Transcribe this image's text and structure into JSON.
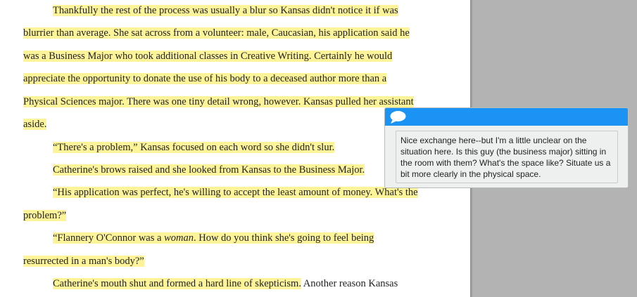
{
  "document": {
    "lines": [
      {
        "hl": "Thankfully the rest of the process was usually a blur so Kansas didn't notice it if was"
      },
      {
        "hl": "blurrier than average. She sat across from a volunteer: male, Caucasian, his application said he"
      },
      {
        "hl": "was a Business Major who took additional classes in Creative Writing. Certainly he would"
      },
      {
        "hl": "appreciate the opportunity to donate the use of his body to a deceased author more than a"
      },
      {
        "hl": "Physical Sciences major. There was one tiny detail wrong, however. Kansas pulled her assistant"
      },
      {
        "hl": "aside."
      },
      {
        "hl": "“There's a problem,” Kansas focused on each word so she didn't slur."
      },
      {
        "hl": "Catherine's brows raised and she looked from Kansas to the Business Major."
      },
      {
        "hl": "“His application was perfect, he's willing to accept the least amount of money. What's the"
      },
      {
        "hl": "problem?”"
      },
      {
        "hl_a": "“Flannery O'Connor was a ",
        "hl_em": "woman",
        "hl_b": ". How do you think she's going to feel being"
      },
      {
        "hl": "resurrected in a man's body?”"
      },
      {
        "hl": "Catherine's mouth shut and formed a hard line of skepticism.",
        "plain": " Another reason Kansas"
      }
    ]
  },
  "comment": {
    "icon": "speech-bubble-icon",
    "text": "Nice exchange here--but I'm a little unclear on the situation here. Is this guy (the business major) sitting in the room with them? What's the space like? Situate us a bit more clearly in the physical space."
  },
  "colors": {
    "highlight": "#fdf49a",
    "comment_header": "#1b93f5",
    "gutter": "#b3b3b3"
  }
}
